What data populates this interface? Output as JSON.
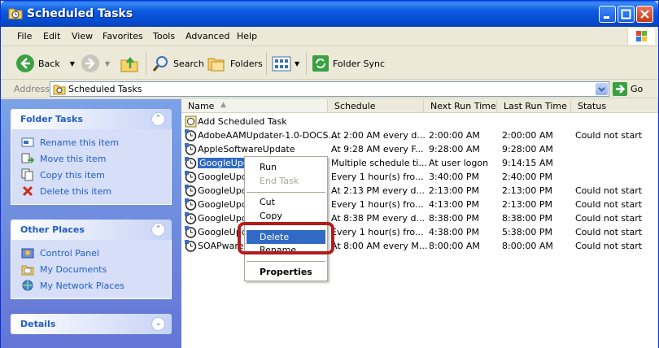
{
  "window": {
    "title": "Scheduled Tasks",
    "icon": "folder-clock-icon"
  },
  "menu": [
    "File",
    "Edit",
    "View",
    "Favorites",
    "Tools",
    "Advanced",
    "Help"
  ],
  "toolbar": {
    "back": "Back",
    "search": "Search",
    "folders": "Folders",
    "folder_sync": "Folder Sync"
  },
  "address": {
    "label": "Address",
    "value": "Scheduled Tasks",
    "go": "Go"
  },
  "folder_tasks": {
    "title": "Folder Tasks",
    "items": [
      {
        "label": "Rename this item",
        "icon": "rename-icon"
      },
      {
        "label": "Move this item",
        "icon": "move-icon"
      },
      {
        "label": "Copy this item",
        "icon": "copy-icon"
      },
      {
        "label": "Delete this item",
        "icon": "delete-x-icon"
      }
    ]
  },
  "other_places": {
    "title": "Other Places",
    "items": [
      {
        "label": "Control Panel",
        "icon": "control-panel-icon"
      },
      {
        "label": "My Documents",
        "icon": "my-documents-icon"
      },
      {
        "label": "My Network Places",
        "icon": "network-places-icon"
      }
    ]
  },
  "details": {
    "title": "Details"
  },
  "columns": [
    "Name",
    "Schedule",
    "Next Run Time",
    "Last Run Time",
    "Status"
  ],
  "rows": [
    {
      "name": "Add Scheduled Task",
      "schedule": "",
      "next": "",
      "last": "",
      "status": ""
    },
    {
      "name": "AdobeAAMUpdater-1.0-DOCS...",
      "schedule": "At 2:00 AM every d...",
      "next": "2:00:00 AM",
      "last": "2:00:00 AM",
      "status": "Could not start"
    },
    {
      "name": "AppleSoftwareUpdate",
      "schedule": "At 9:28 AM every F...",
      "next": "9:28:00 AM",
      "last": "9:28:00 AM",
      "status": ""
    },
    {
      "name": "GoogleUpda",
      "schedule": "Multiple schedule ti...",
      "next": "At user logon",
      "last": "9:14:15 AM",
      "status": ""
    },
    {
      "name": "GoogleUpda",
      "schedule": "Every 1 hour(s) fro...",
      "next": "3:40:00 PM",
      "last": "2:40:00 PM",
      "status": ""
    },
    {
      "name": "GoogleUpda",
      "schedule": "At 2:13 PM every d...",
      "next": "2:13:00 PM",
      "last": "2:13:00 PM",
      "status": "Could not start"
    },
    {
      "name": "GoogleUpda",
      "schedule": "Every 1 hour(s) fro...",
      "next": "4:13:00 PM",
      "last": "2:13:00 PM",
      "status": "Could not start"
    },
    {
      "name": "GoogleUpda",
      "schedule": "At 8:38 PM every d...",
      "next": "8:38:00 PM",
      "last": "8:38:00 PM",
      "status": "Could not start"
    },
    {
      "name": "GoogleUpd",
      "schedule": "Every 1 hour(s) fro...",
      "next": "4:38:00 PM",
      "last": "5:38:00 PM",
      "status": "Could not start"
    },
    {
      "name": "SOAPware S",
      "schedule": "At 8:00 AM every M...",
      "next": "8:00:00 AM",
      "last": "8:00:00 AM",
      "status": "Could not start"
    }
  ],
  "context_menu": {
    "run": "Run",
    "end_task": "End Task",
    "cut": "Cut",
    "copy": "Copy",
    "delete": "Delete",
    "rename": "Rename",
    "properties": "Properties"
  },
  "colors": {
    "highlight": "#316ac5",
    "callout": "#b21c1c",
    "task_link": "#215dc6"
  }
}
